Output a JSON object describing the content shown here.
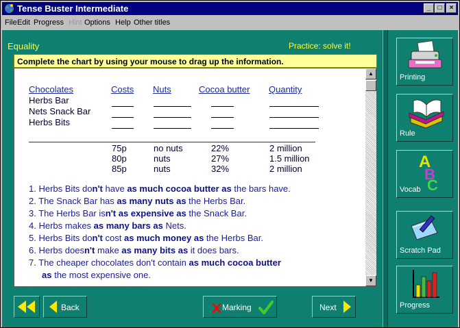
{
  "window": {
    "title": "Tense Buster Intermediate",
    "minimize": "_",
    "maximize": "□",
    "close": "×"
  },
  "menu": [
    {
      "label": "File"
    },
    {
      "label": "Edit"
    },
    {
      "label": "Progress"
    },
    {
      "label": "Hint"
    },
    {
      "label": "Options"
    },
    {
      "label": "Help"
    },
    {
      "label": "Other titles"
    }
  ],
  "lesson": {
    "title": "Equality",
    "mode": "Practice: solve it!",
    "instruction": "Complete the chart by using your mouse to drag up the information."
  },
  "chart": {
    "headers": [
      "Chocolates",
      "Costs",
      "Nuts",
      "Cocoa butter",
      "Quantity"
    ],
    "products": [
      "Herbs Bar",
      "Nets Snack Bar",
      "Herbs Bits"
    ],
    "options": {
      "costs": [
        "75p",
        "80p",
        "85p"
      ],
      "nuts": [
        "no nuts",
        "nuts",
        "nuts"
      ],
      "cocoa": [
        "22%",
        "27%",
        "32%"
      ],
      "quantity": [
        "2 million",
        "1.5 million",
        "2 million"
      ]
    }
  },
  "clues": [
    {
      "n": "1. ",
      "a": "Herbs Bits do",
      "b": "n't",
      "c": " have ",
      "d": "as much cocoa butter as",
      "e": " the bars have."
    },
    {
      "n": "2. ",
      "a": "The Snack Bar has ",
      "b": "as many nuts as",
      "c": " the Herbs Bar.",
      "d": "",
      "e": ""
    },
    {
      "n": "3. ",
      "a": "The Herbs Bar is",
      "b": "n't as expensive as",
      "c": " the Snack Bar.",
      "d": "",
      "e": ""
    },
    {
      "n": "4. ",
      "a": "Herbs makes ",
      "b": "as many bars as",
      "c": " Nets.",
      "d": "",
      "e": ""
    },
    {
      "n": "5. ",
      "a": "Herbs Bits do",
      "b": "n't",
      "c": " cost ",
      "d": "as much money as",
      "e": " the Herbs Bar."
    },
    {
      "n": "6. ",
      "a": "Herbs does",
      "b": "n't",
      "c": " make ",
      "d": "as many bits as",
      "e": " it does bars."
    },
    {
      "n": "7. ",
      "a": "The cheaper chocolates don't contain ",
      "b": "as much cocoa butter",
      "c": "",
      "d": "",
      "e": ""
    },
    {
      "n": "",
      "a": "",
      "b": "as",
      "c": " the most expensive one.",
      "d": "",
      "e": ""
    }
  ],
  "nav": {
    "back": "Back",
    "marking": "Marking",
    "next": "Next"
  },
  "tools": [
    "Printing",
    "Rule",
    "Vocab",
    "Scratch Pad",
    "Progress"
  ],
  "colors": {
    "background": "#0f7f6f",
    "accent_text": "#ffff30",
    "instruction_bg": "#ffff99",
    "clue_text": "#1a1aa8",
    "marking_check": "#3ccf2a",
    "marking_cross": "#e01010"
  }
}
